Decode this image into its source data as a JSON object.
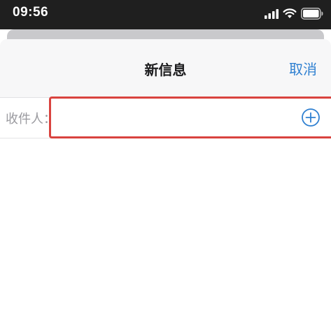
{
  "status_bar": {
    "time": "09:56",
    "icons": [
      "signal-icon",
      "wifi-icon",
      "battery-icon"
    ]
  },
  "nav": {
    "title": "新信息",
    "cancel_label": "取消"
  },
  "recipient": {
    "label": "收件人：",
    "value": "",
    "add_icon": "plus-circle-icon"
  },
  "colors": {
    "accent": "#2f80d1",
    "highlight_border": "#d9433f",
    "status_bar_bg": "#1f1f1f",
    "nav_bg": "#f7f7f8",
    "label_gray": "#9a9a9f"
  }
}
